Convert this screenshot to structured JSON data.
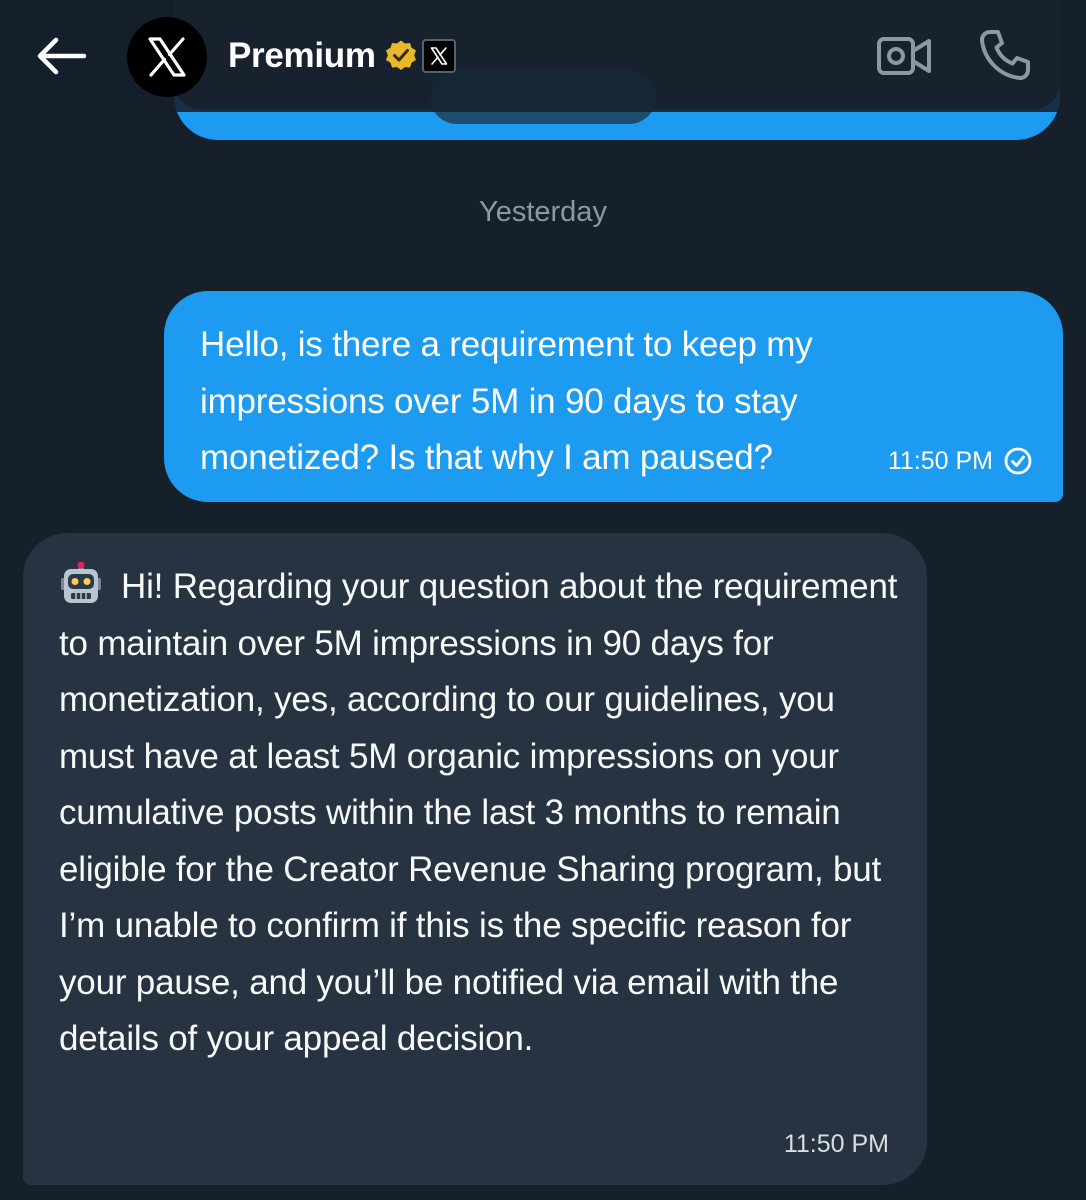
{
  "header": {
    "title": "Premium",
    "back_icon": "arrow-left-icon",
    "avatar_icon": "x-logo-icon",
    "verified_icon": "verified-badge-icon",
    "affiliate_icon": "x-affiliate-badge-icon",
    "video_icon": "video-camera-icon",
    "phone_icon": "phone-icon"
  },
  "conversation": {
    "date_separator": "Yesterday",
    "messages": [
      {
        "direction": "outgoing",
        "text": "Hello, is there a requirement to keep my impressions over 5M in 90 days to stay monetized? Is that why I am paused?",
        "time": "11:50 PM",
        "status_icon": "sent-check-icon"
      },
      {
        "direction": "incoming",
        "emoji_icon": "robot-icon",
        "text": "Hi! Regarding your question about the requirement to maintain over 5M impressions in 90 days for monetization, yes, according to our guidelines, you must have at least 5M organic impressions on your cumulative posts within the last 3 months to remain eligible for the Creator Revenue Sharing program, but I’m unable to confirm if this is the specific reason for your pause, and you’ll be notified via email with the details of your appeal decision.",
        "time": "11:50 PM"
      }
    ]
  },
  "colors": {
    "background": "#15202b",
    "outgoing_bubble": "#1d9bf0",
    "incoming_bubble": "#273340",
    "verified_gold": "#e8b829"
  }
}
